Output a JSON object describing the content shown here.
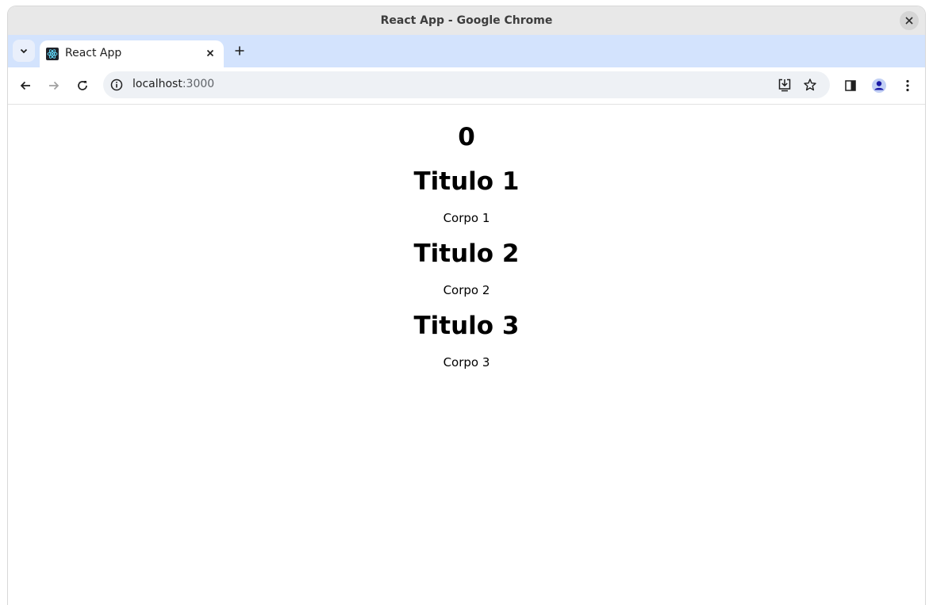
{
  "window": {
    "title": "React App - Google Chrome"
  },
  "tabs": [
    {
      "label": "React App",
      "active": true
    }
  ],
  "icons": {
    "tab_search": "chevron-down-icon",
    "favicon": "react-logo-icon",
    "tab_close": "close-icon",
    "new_tab": "plus-icon",
    "back": "arrow-left-icon",
    "forward": "arrow-right-icon",
    "reload": "reload-icon",
    "site_info": "info-icon",
    "install": "install-app-icon",
    "bookmark": "star-icon",
    "side_panel": "side-panel-icon",
    "profile": "profile-icon",
    "menu": "kebab-menu-icon",
    "window_close": "close-icon"
  },
  "address_bar": {
    "host": "localhost",
    "port": ":3000"
  },
  "page": {
    "counter": "0",
    "posts": [
      {
        "title": "Titulo 1",
        "body": "Corpo 1"
      },
      {
        "title": "Titulo 2",
        "body": "Corpo 2"
      },
      {
        "title": "Titulo 3",
        "body": "Corpo 3"
      }
    ]
  },
  "colors": {
    "tabstrip": "#d3e3fd",
    "titlebar": "#e8e8e8",
    "profile_accent": "#1a1aa6"
  }
}
